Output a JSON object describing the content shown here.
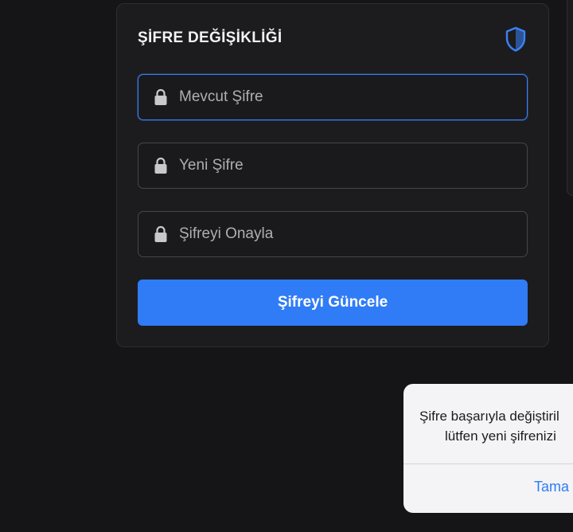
{
  "password_card": {
    "title": "ŞİFRE DEĞİŞİKLİĞİ",
    "shield_icon": "shield-icon",
    "fields": [
      {
        "placeholder": "Mevcut Şifre",
        "value": "",
        "icon": "lock-icon",
        "focused": true
      },
      {
        "placeholder": "Yeni Şifre",
        "value": "",
        "icon": "lock-icon",
        "focused": false
      },
      {
        "placeholder": "Şifreyi Onayla",
        "value": "",
        "icon": "lock-icon",
        "focused": false
      }
    ],
    "submit_label": "Şifreyi Güncele"
  },
  "alert": {
    "message_line1": "Şifre başarıyla değiştiril",
    "message_line2": "lütfen yeni şifrenizi",
    "button_label": "Tama"
  },
  "colors": {
    "background": "#151517",
    "card": "#1c1c1f",
    "accent": "#2f7cf6",
    "focus_border": "#3b82f6",
    "alert_bg": "#f4f4f6"
  }
}
